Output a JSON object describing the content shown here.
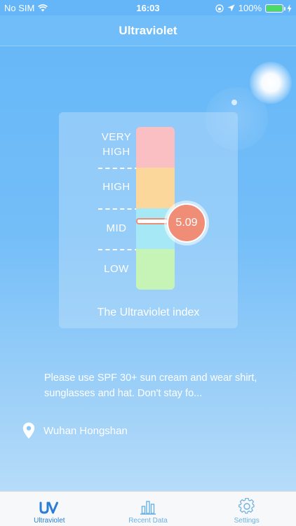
{
  "status_bar": {
    "carrier": "No SIM",
    "time": "16:03",
    "battery": "100%"
  },
  "nav": {
    "title": "Ultraviolet"
  },
  "uv_scale": {
    "levels": {
      "very_high": "VERY HIGH",
      "high": "HIGH",
      "mid": "MID",
      "low": "LOW"
    },
    "value": "5.09",
    "caption": "The Ultraviolet index",
    "colors": {
      "very_high": "#f9bfc3",
      "high": "#fcd79c",
      "mid": "#a6e8f6",
      "low": "#c6f4b6",
      "marker": "#ef8d77"
    }
  },
  "advice": "Please use SPF 30+ sun cream and wear shirt, sunglasses and hat. Don't stay fo...",
  "location": {
    "icon": "map-pin-icon",
    "name": "Wuhan Hongshan"
  },
  "tabs": [
    {
      "label": "Ultraviolet",
      "icon": "uv-icon",
      "active": true
    },
    {
      "label": "Recent Data",
      "icon": "bar-chart-icon",
      "active": false
    },
    {
      "label": "Settings",
      "icon": "gear-icon",
      "active": false
    }
  ]
}
